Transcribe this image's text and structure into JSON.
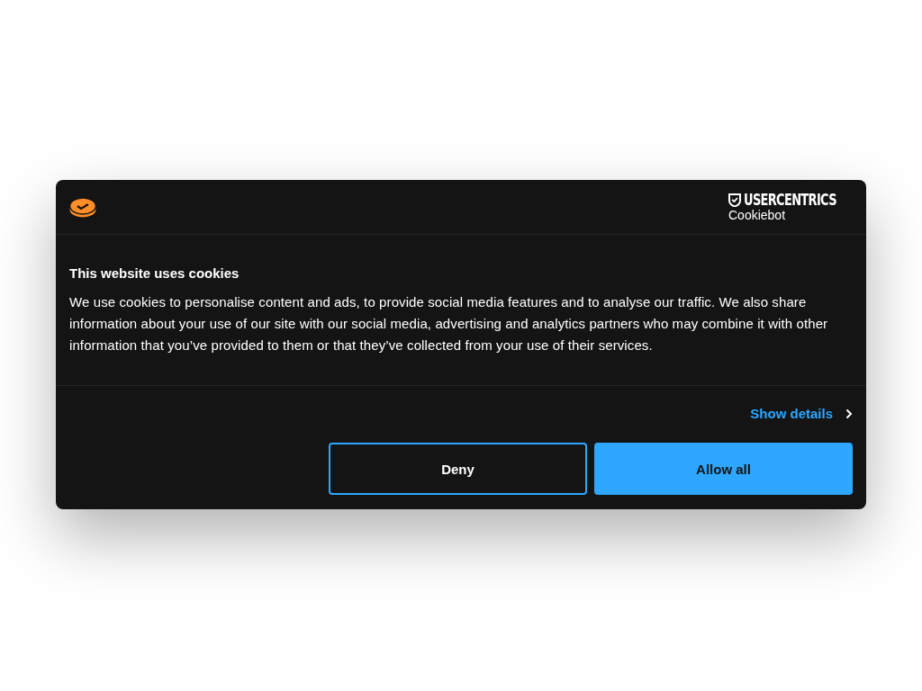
{
  "header": {
    "brand": "USERCENTRICS",
    "product": "Cookiebot"
  },
  "title": "This website uses cookies",
  "body": "We use cookies to personalise content and ads, to provide social media features and to analyse our traffic. We also share information about your use of our site with our social media, advertising and analytics partners who may combine it with other information that you’ve provided to them or that they’ve collected from your use of their services.",
  "details_link": "Show details",
  "buttons": [
    {
      "label": "Deny",
      "kind": "outline"
    },
    {
      "label": "Allow all",
      "kind": "primary"
    }
  ]
}
